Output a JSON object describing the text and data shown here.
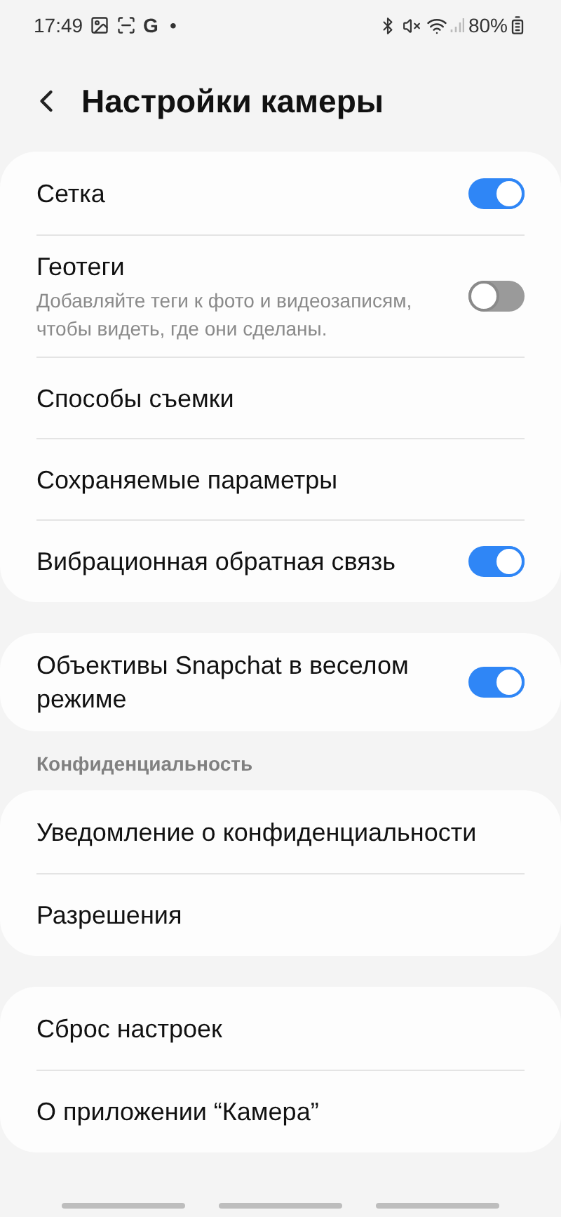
{
  "status_bar": {
    "time": "17:49",
    "app_letter": "G",
    "dot": "•",
    "battery": "80%"
  },
  "header": {
    "title": "Настройки камеры"
  },
  "groups": [
    {
      "items": [
        {
          "kind": "toggle",
          "title": "Сетка",
          "on": true
        },
        {
          "kind": "toggle",
          "title": "Геотеги",
          "subtitle": "Добавляйте теги к фото и видеозаписям, чтобы видеть, где они сделаны.",
          "on": false
        },
        {
          "kind": "link",
          "title": "Способы съемки"
        },
        {
          "kind": "link",
          "title": "Сохраняемые параметры"
        },
        {
          "kind": "toggle",
          "title": "Вибрационная обратная связь",
          "on": true
        }
      ]
    },
    {
      "items": [
        {
          "kind": "toggle",
          "title": "Объективы Snapchat в веселом режиме",
          "on": true
        }
      ]
    },
    {
      "label": "Конфиденциальность",
      "items": [
        {
          "kind": "link",
          "title": "Уведомление о конфиденциальности"
        },
        {
          "kind": "link",
          "title": "Разрешения"
        }
      ]
    },
    {
      "items": [
        {
          "kind": "link",
          "title": "Сброс настроек"
        },
        {
          "kind": "link",
          "title": "О приложении “Камера”"
        }
      ]
    }
  ]
}
